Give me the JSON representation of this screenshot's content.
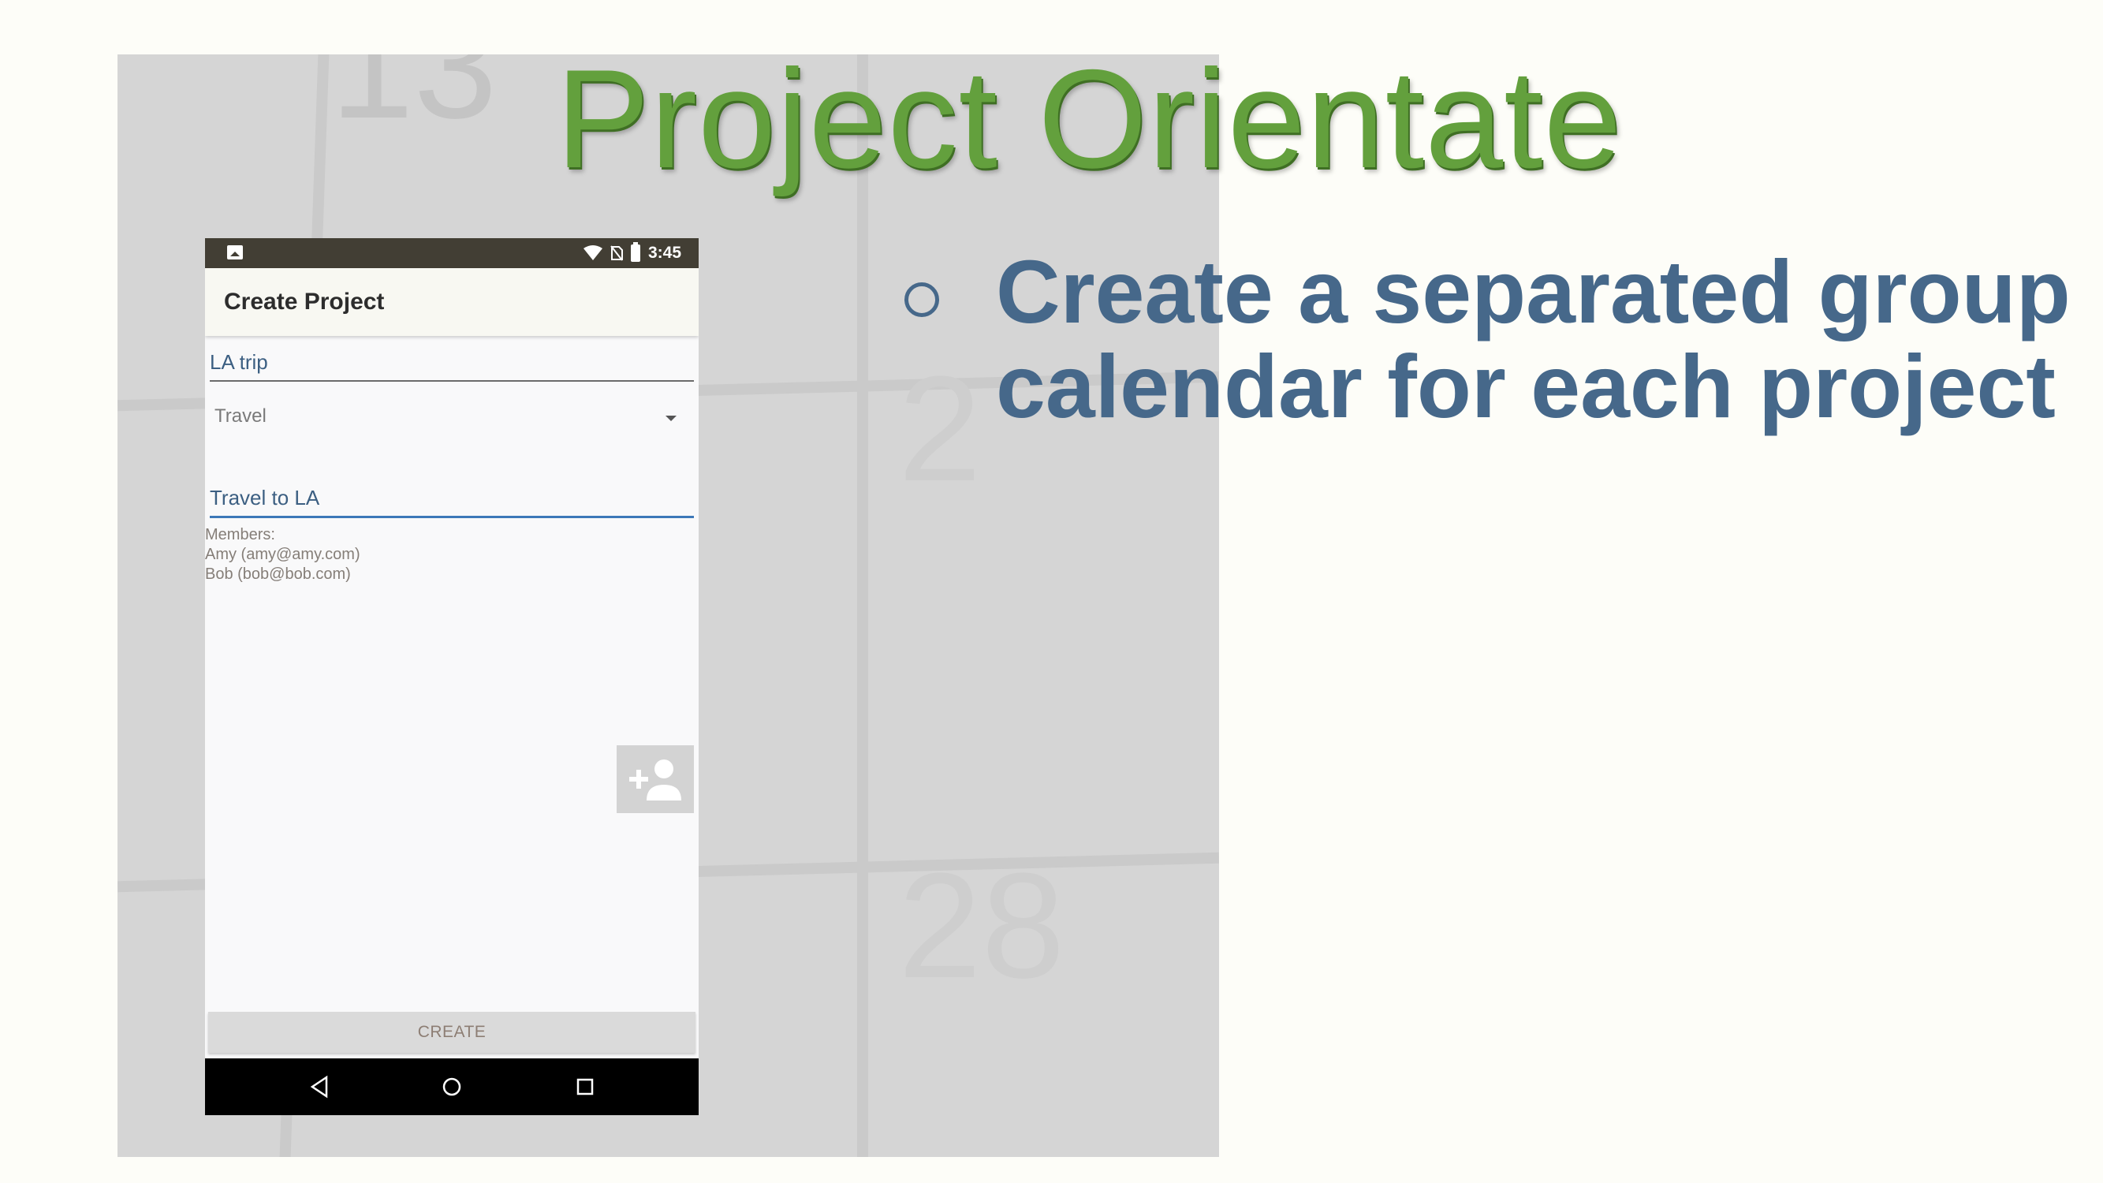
{
  "slide": {
    "title": "Project Orientate",
    "bullet": "Create a separated group calendar for each project"
  },
  "background": {
    "calendar_numbers": [
      "13",
      "2",
      "28"
    ]
  },
  "phone": {
    "status_bar": {
      "time": "3:45",
      "icons": [
        "gallery-icon",
        "wifi-icon",
        "no-sim-icon",
        "battery-icon"
      ]
    },
    "app_bar": {
      "title": "Create Project"
    },
    "form": {
      "project_name": "LA trip",
      "category": "Travel",
      "description": "Travel to LA",
      "members_label": "Members:",
      "members": [
        "Amy (amy@amy.com)",
        "Bob (bob@bob.com)"
      ],
      "create_label": "CREATE"
    },
    "nav_bar": {
      "icons": [
        "back-icon",
        "home-icon",
        "recents-icon"
      ]
    }
  },
  "colors": {
    "title_green": "#63a03d",
    "bullet_blue": "#46688a",
    "field_text": "#3c5f82",
    "focus_underline": "#3d78b8"
  }
}
